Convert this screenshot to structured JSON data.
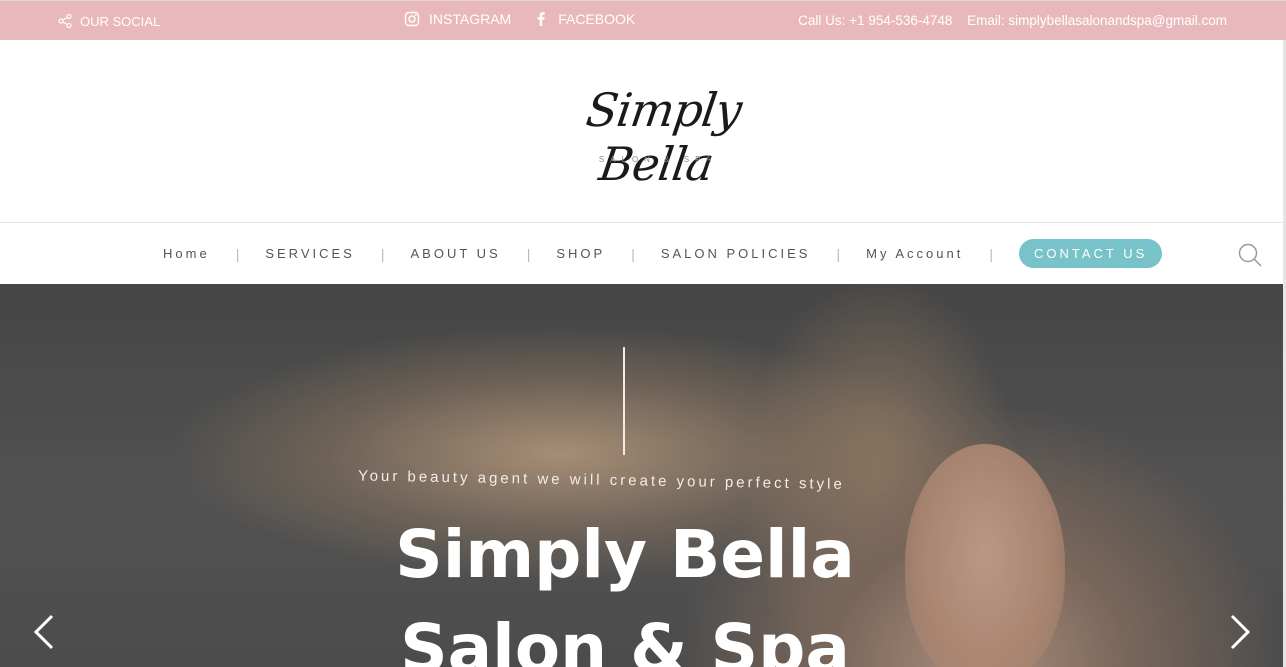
{
  "topbar": {
    "social_label": "OUR SOCIAL",
    "instagram_label": "INSTAGRAM",
    "facebook_label": "FACEBOOK",
    "phone_text": "Call Us: +1 954-536-4748",
    "email_text": "Email: simplybellasalonandspa@gmail.com",
    "background_color": "#e9b8bd"
  },
  "header": {
    "logo_script": "Simply Bella",
    "logo_sub": "SALON & SPA"
  },
  "nav": {
    "items": [
      {
        "label": "Home"
      },
      {
        "label": "SERVICES"
      },
      {
        "label": "ABOUT US"
      },
      {
        "label": "SHOP"
      },
      {
        "label": "SALON POLICIES"
      },
      {
        "label": "My Account"
      }
    ],
    "separator": "|",
    "contact_button": "CONTACT US",
    "contact_color": "#78c3c9",
    "search_icon": "search-icon"
  },
  "hero": {
    "tagline": "Your beauty agent we will create your perfect style",
    "title_line1": "Simply Bella",
    "title_line2": "Salon & Spa",
    "prev_icon": "chevron-left-icon",
    "next_icon": "chevron-right-icon"
  }
}
